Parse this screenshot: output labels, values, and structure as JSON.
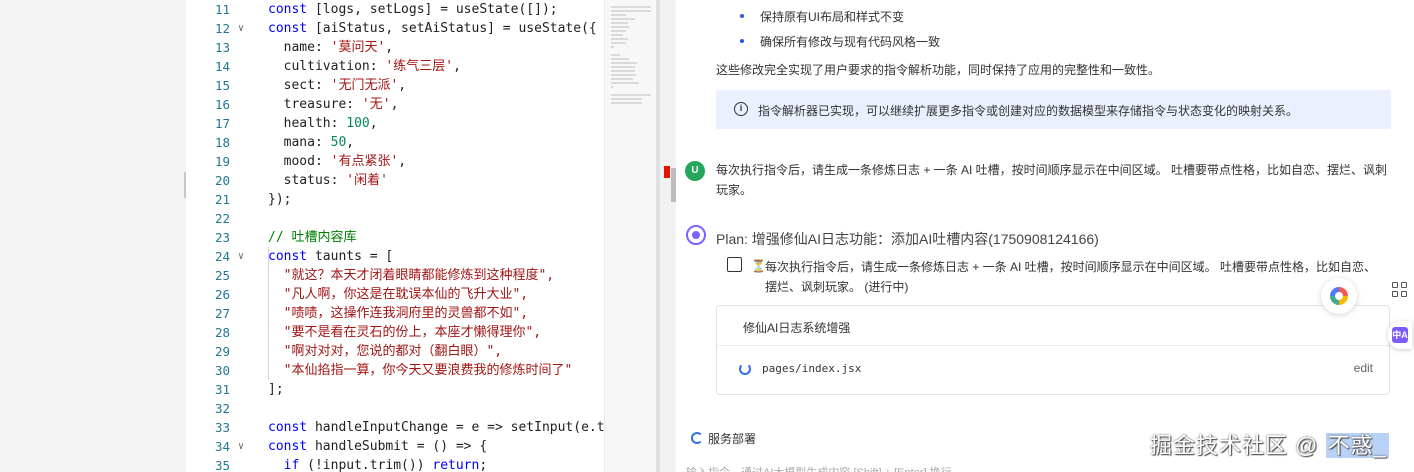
{
  "editor": {
    "line_numbers": [
      "11",
      "12",
      "13",
      "14",
      "15",
      "16",
      "17",
      "18",
      "19",
      "20",
      "21",
      "22",
      "23",
      "24",
      "25",
      "26",
      "27",
      "28",
      "29",
      "30",
      "31",
      "32",
      "33",
      "34",
      "35"
    ],
    "lines": [
      {
        "fold": "",
        "segments": [
          {
            "t": "const",
            "c": "kw"
          },
          {
            "t": " [logs, setLogs] = useState([]);",
            "c": ""
          }
        ]
      },
      {
        "fold": "v",
        "segments": [
          {
            "t": "const",
            "c": "kw"
          },
          {
            "t": " [aiStatus, setAiStatus] = useState({",
            "c": ""
          }
        ]
      },
      {
        "fold": "",
        "segments": [
          {
            "t": "  name: ",
            "c": ""
          },
          {
            "t": "'莫问天'",
            "c": "str"
          },
          {
            "t": ",",
            "c": ""
          }
        ]
      },
      {
        "fold": "",
        "segments": [
          {
            "t": "  cultivation: ",
            "c": ""
          },
          {
            "t": "'练气三层'",
            "c": "str"
          },
          {
            "t": ",",
            "c": ""
          }
        ]
      },
      {
        "fold": "",
        "segments": [
          {
            "t": "  sect: ",
            "c": ""
          },
          {
            "t": "'无门无派'",
            "c": "str"
          },
          {
            "t": ",",
            "c": ""
          }
        ]
      },
      {
        "fold": "",
        "segments": [
          {
            "t": "  treasure: ",
            "c": ""
          },
          {
            "t": "'无'",
            "c": "str"
          },
          {
            "t": ",",
            "c": ""
          }
        ]
      },
      {
        "fold": "",
        "segments": [
          {
            "t": "  health: ",
            "c": ""
          },
          {
            "t": "100",
            "c": "num"
          },
          {
            "t": ",",
            "c": ""
          }
        ]
      },
      {
        "fold": "",
        "segments": [
          {
            "t": "  mana: ",
            "c": ""
          },
          {
            "t": "50",
            "c": "num"
          },
          {
            "t": ",",
            "c": ""
          }
        ]
      },
      {
        "fold": "",
        "segments": [
          {
            "t": "  mood: ",
            "c": ""
          },
          {
            "t": "'有点紧张'",
            "c": "str"
          },
          {
            "t": ",",
            "c": ""
          }
        ]
      },
      {
        "fold": "",
        "segments": [
          {
            "t": "  status: ",
            "c": ""
          },
          {
            "t": "'闲着'",
            "c": "str"
          }
        ]
      },
      {
        "fold": "",
        "segments": [
          {
            "t": "});",
            "c": ""
          }
        ]
      },
      {
        "fold": "",
        "segments": []
      },
      {
        "fold": "",
        "segments": [
          {
            "t": "// 吐槽内容库",
            "c": "cmt"
          }
        ]
      },
      {
        "fold": "v",
        "segments": [
          {
            "t": "const",
            "c": "kw"
          },
          {
            "t": " taunts = [",
            "c": ""
          }
        ]
      },
      {
        "fold": "",
        "segments": [
          {
            "t": "  \"就这？本天才闭着眼睛都能修炼到这种程度\",",
            "c": "str"
          }
        ]
      },
      {
        "fold": "",
        "segments": [
          {
            "t": "  \"凡人啊，你这是在耽误本仙的飞升大业\",",
            "c": "str"
          }
        ]
      },
      {
        "fold": "",
        "segments": [
          {
            "t": "  \"啧啧，这操作连我洞府里的灵兽都不如\",",
            "c": "str"
          }
        ]
      },
      {
        "fold": "",
        "segments": [
          {
            "t": "  \"要不是看在灵石的份上，本座才懒得理你\",",
            "c": "str"
          }
        ]
      },
      {
        "fold": "",
        "segments": [
          {
            "t": "  \"啊对对对，您说的都对（翻白眼）\",",
            "c": "str"
          }
        ]
      },
      {
        "fold": "",
        "segments": [
          {
            "t": "  \"本仙掐指一算，你今天又要浪费我的修炼时间了\"",
            "c": "str"
          }
        ]
      },
      {
        "fold": "",
        "segments": [
          {
            "t": "];",
            "c": ""
          }
        ]
      },
      {
        "fold": "",
        "segments": []
      },
      {
        "fold": "",
        "segments": [
          {
            "t": "const",
            "c": "kw"
          },
          {
            "t": " handleInputChange = e => setInput(e.ta",
            "c": ""
          }
        ]
      },
      {
        "fold": "v",
        "segments": [
          {
            "t": "const",
            "c": "kw"
          },
          {
            "t": " handleSubmit = () => {",
            "c": ""
          }
        ]
      },
      {
        "fold": "",
        "segments": [
          {
            "t": "  ",
            "c": ""
          },
          {
            "t": "if",
            "c": "kw"
          },
          {
            "t": " (!input.trim()) ",
            "c": ""
          },
          {
            "t": "return",
            "c": "kw"
          },
          {
            "t": ";",
            "c": ""
          }
        ]
      }
    ]
  },
  "chat": {
    "bullets": [
      "保持原有UI布局和样式不变",
      "确保所有修改与现有代码风格一致"
    ],
    "summary": "这些修改完全实现了用户要求的指令解析功能，同时保持了应用的完整性和一致性。",
    "info_icon": "i",
    "info_text": "指令解析器已实现，可以继续扩展更多指令或创建对应的数据模型来存储指令与状态变化的映射关系。",
    "user_avatar": "U",
    "user_message": "每次执行指令后，请生成一条修炼日志 + 一条 AI 吐槽，按时间顺序显示在中间区域。 吐槽要带点性格，比如自恋、摆烂、讽刺玩家。",
    "plan_title": "Plan: 增强修仙AI日志功能：添加AI吐槽内容(1750908124166)",
    "task_icon": "⏳",
    "task_text": "每次执行指令后，请生成一条修炼日志 + 一条 AI 吐槽，按时间顺序显示在中间区域。 吐槽要带点性格，比如自恋、摆烂、讽刺玩家。 (进行中)",
    "card": {
      "title": "修仙AI日志系统增强",
      "file_path": "pages/index.jsx",
      "edit_label": "edit"
    },
    "service_label": "服务部署",
    "input_hint": "输入指令，通过AI大模型生成内容 [Shift] + [Enter] 换行",
    "translate_icon": "中A"
  },
  "watermark": {
    "main": "掘金技术社区 @ ",
    "highlight": "不惑_"
  }
}
